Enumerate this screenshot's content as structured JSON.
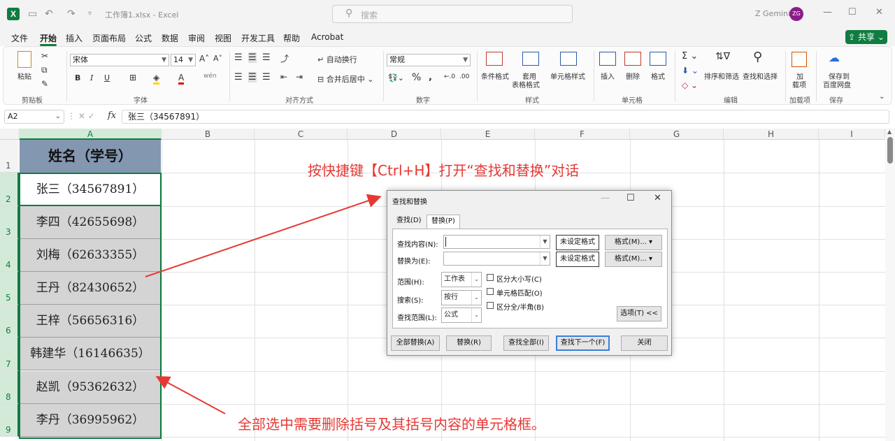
{
  "titlebar": {
    "app_icon_letter": "X",
    "doc_title": "工作簿1.xlsx - Excel",
    "search_placeholder": "搜索",
    "user_name": "Z Gemini",
    "avatar_initials": "ZG"
  },
  "menu": {
    "items": [
      "文件",
      "开始",
      "插入",
      "页面布局",
      "公式",
      "数据",
      "审阅",
      "视图",
      "开发工具",
      "帮助",
      "Acrobat"
    ],
    "active": "开始",
    "share_label": "共享"
  },
  "ribbon": {
    "clipboard": {
      "paste": "粘贴",
      "label": "剪贴板"
    },
    "font": {
      "name": "宋体",
      "size": "14",
      "bold": "B",
      "italic": "I",
      "underline": "U",
      "label": "字体"
    },
    "alignment": {
      "wrap": "自动换行",
      "merge": "合并后居中",
      "label": "对齐方式"
    },
    "number": {
      "format": "常规",
      "percent": "%",
      "label": "数字"
    },
    "styles": {
      "conditional": "条件格式",
      "table_1": "套用",
      "table_2": "表格格式",
      "cell_styles": "单元格样式",
      "label": "样式"
    },
    "cells": {
      "insert": "插入",
      "delete": "删除",
      "format": "格式",
      "label": "单元格"
    },
    "editing": {
      "sort": "排序和筛选",
      "find": "查找和选择",
      "label": "编辑"
    },
    "addins": {
      "name_1": "加",
      "name_2": "载项",
      "label": "加载项"
    },
    "save": {
      "name_1": "保存到",
      "name_2": "百度网盘",
      "label": "保存"
    }
  },
  "formula_bar": {
    "name_box": "A2",
    "fx": "fx",
    "content": "张三（34567891）"
  },
  "grid": {
    "columns": [
      "A",
      "B",
      "C",
      "D",
      "E",
      "F",
      "G",
      "H",
      "I"
    ],
    "rows": [
      "1",
      "2",
      "3",
      "4",
      "5",
      "6",
      "7",
      "8",
      "9"
    ],
    "header_cell": "姓名（学号）",
    "cells": [
      "张三（34567891）",
      "李四（42655698）",
      "刘梅（62633355）",
      "王丹（82430652）",
      "王梓（56656316）",
      "韩建华（16146635）",
      "赵凯（95362632）",
      "李丹（36995962）"
    ]
  },
  "annotations": {
    "top": "按快捷键【Ctrl+H】打开“查找和替换”对话",
    "bottom": "全部选中需要删除括号及其括号内容的单元格框。",
    "color": "#e53935"
  },
  "dialog": {
    "title": "查找和替换",
    "tabs": [
      "查找(D)",
      "替换(P)"
    ],
    "find_label": "查找内容(N):",
    "replace_label": "替换为(E):",
    "no_format_1": "未设定格式",
    "no_format_2": "未设定格式",
    "format_btn_1": "格式(M)...",
    "format_btn_2": "格式(M)...",
    "scope_label": "范围(H):",
    "scope_value": "工作表",
    "search_label": "搜索(S):",
    "search_value": "按行",
    "lookin_label": "查找范围(L):",
    "lookin_value": "公式",
    "match_case": "区分大小写(C)",
    "match_cell": "单元格匹配(O)",
    "match_width": "区分全/半角(B)",
    "options_btn": "选项(T) <<",
    "replace_all": "全部替换(A)",
    "replace": "替换(R)",
    "find_all": "查找全部(I)",
    "find_next": "查找下一个(F)",
    "close": "关闭"
  }
}
